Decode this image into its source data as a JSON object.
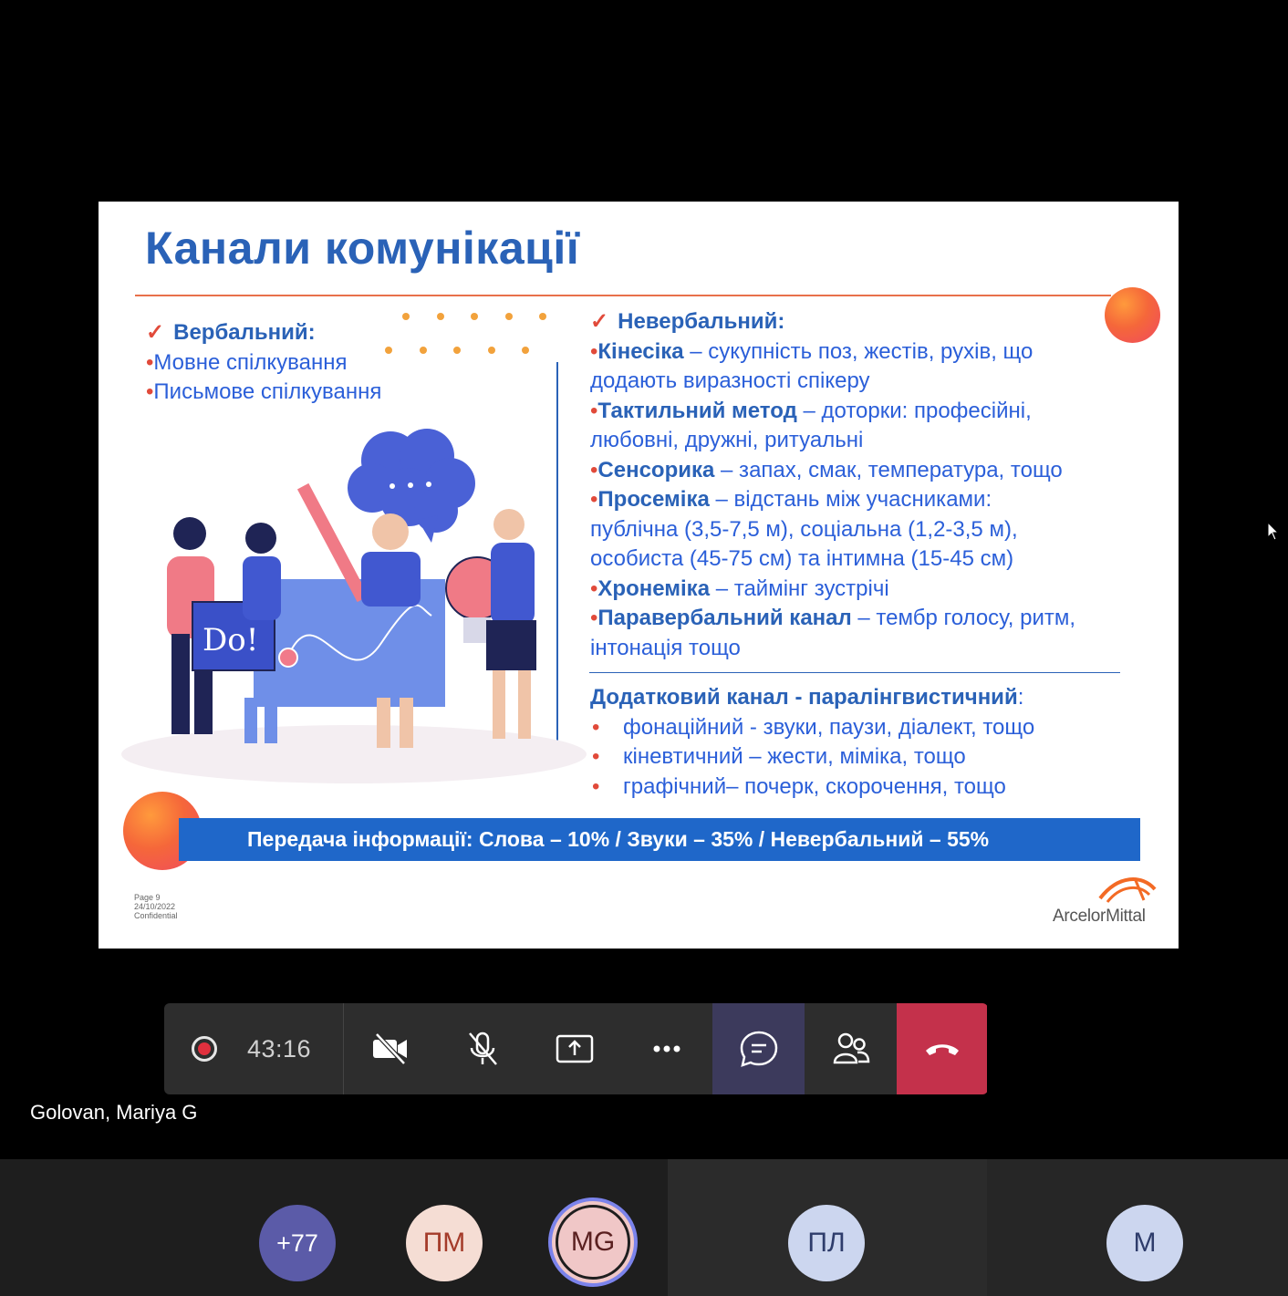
{
  "slide": {
    "title": "Канали комунікації",
    "verbal_heading": "Вербальний:",
    "verbal_items": [
      "Мовне спілкування",
      "Письмове спілкування"
    ],
    "nonverbal_heading": "Невербальний:",
    "nonverbal_lines": [
      {
        "term": "Кінесіка",
        "text": " – сукупність поз, жестів, рухів, що"
      },
      {
        "term": "",
        "text": "додають виразності спікеру"
      },
      {
        "term": "Тактильний метод",
        "text": " – доторки: професійні,"
      },
      {
        "term": "",
        "text": "любовні, дружні, ритуальні"
      },
      {
        "term": "Сенсорика",
        "text": " – запах, смак, температура, тощо"
      },
      {
        "term": "Просеміка",
        "text": " – відстань між учасниками:"
      },
      {
        "term": "",
        "text": "публічна (3,5-7,5 м), соціальна (1,2-3,5 м),"
      },
      {
        "term": "",
        "text": "особиста (45-75 см) та інтимна (15-45 см)"
      },
      {
        "term": "Хронеміка",
        "text": " – таймінг зустрічі"
      },
      {
        "term": "Паравербальний канал",
        "text": " – тембр голосу, ритм,"
      },
      {
        "term": "",
        "text": "інтонація тощо"
      }
    ],
    "extra_heading": "Додатковий канал - паралінгвистичний",
    "extra_colon": ":",
    "extra_items": [
      "фонаційний - звуки, паузи, діалект, тощо",
      "кіневтичний – жести, міміка, тощо",
      "графічний– почерк, скорочення, тощо"
    ],
    "banner": "Передача інформації: Слова – 10% / Звуки – 35% / Невербальний – 55%",
    "footer_page": "Page 9",
    "footer_date": "24/10/2022",
    "footer_conf": "Confidential",
    "logo_text": "ArcelorMittal",
    "sign_text": "Do!"
  },
  "toolbar": {
    "timer": "43:16"
  },
  "presenter_name": "Golovan, Mariya G",
  "participants": [
    {
      "initials": "+77"
    },
    {
      "initials": "ПМ"
    },
    {
      "initials": "MG"
    },
    {
      "initials": "ПЛ"
    },
    {
      "initials": "M"
    }
  ],
  "colors": {
    "slide_blue": "#2a62b7",
    "banner_blue": "#1f67c9",
    "accent_red": "#e14a3a",
    "hangup": "#c4314b",
    "chat_active": "#3c3a5c"
  }
}
